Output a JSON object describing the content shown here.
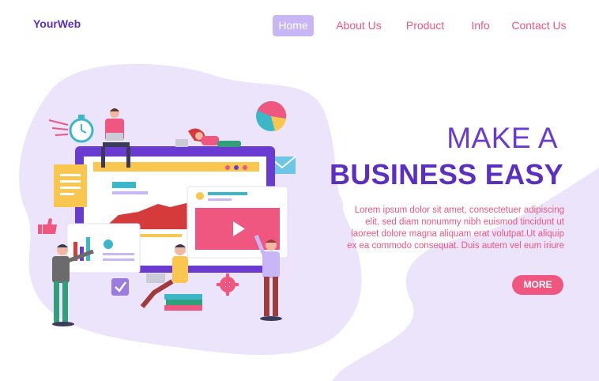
{
  "brand": {
    "name": "YourWeb"
  },
  "nav": {
    "items": [
      {
        "label": "Home",
        "active": true
      },
      {
        "label": "About Us",
        "active": false
      },
      {
        "label": "Product",
        "active": false
      },
      {
        "label": "Info",
        "active": false
      },
      {
        "label": "Contact Us",
        "active": false
      }
    ]
  },
  "hero": {
    "title_line1": "MAKE A",
    "title_line2": "BUSINESS EASY",
    "body": "Lorem ipsum dolor sit amet, consectetuer adipiscing elit, sed diam nonummy nibh euismod tincidunt ut laoreet dolore magna aliquam erat volutpat.Ut aliquip ex ea commodo consequat. Duis autem vel eum iriure",
    "button_label": "MORE"
  },
  "colors": {
    "brand": "#5b2fc2",
    "accent": "#ef5680",
    "blob": "#ebe4fb",
    "nav_active_bg": "#c8b6f6"
  },
  "illustration": {
    "icons": [
      "stopwatch-icon",
      "pie-chart-icon",
      "mail-icon",
      "thumbs-up-icon",
      "checkbox-icon",
      "gear-icon",
      "play-icon",
      "document-icon",
      "bar-chart-icon"
    ]
  }
}
